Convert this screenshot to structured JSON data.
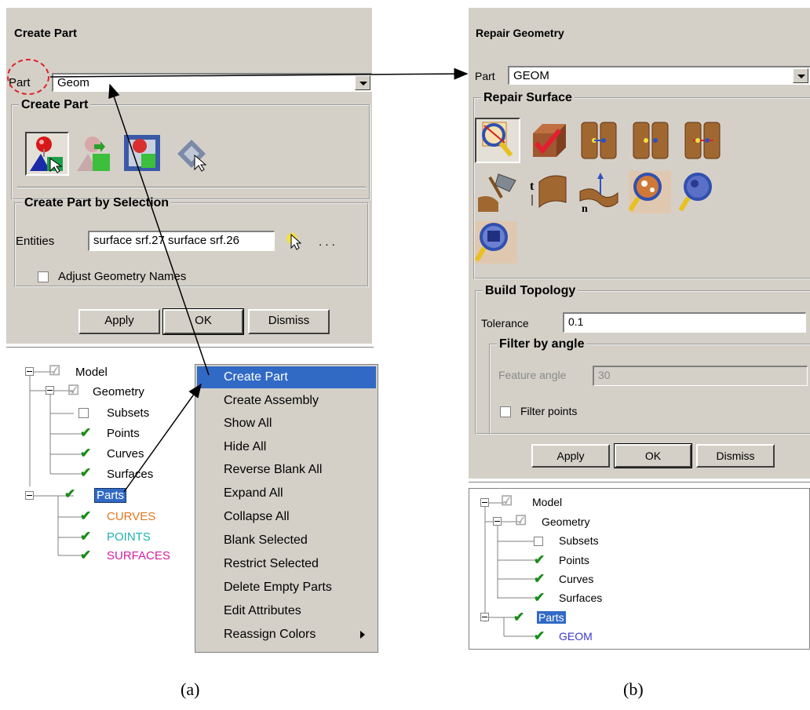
{
  "left": {
    "title": "Create Part",
    "part_label": "Part",
    "part_value": "Geom",
    "create_part_group": "Create Part",
    "selection_group": "Create Part by Selection",
    "entities_label": "Entities",
    "entities_value": "surface srf.27 surface srf.26",
    "dots": ". . .",
    "adjust_label": "Adjust Geometry Names",
    "apply": "Apply",
    "ok": "OK",
    "dismiss": "Dismiss",
    "tree": {
      "model": "Model",
      "geometry": "Geometry",
      "subsets": "Subsets",
      "points": "Points",
      "curves": "Curves",
      "surfaces": "Surfaces",
      "parts": "Parts",
      "part_items": [
        {
          "label": "CURVES",
          "color": "#e07820"
        },
        {
          "label": "POINTS",
          "color": "#20b0b0"
        },
        {
          "label": "SURFACES",
          "color": "#d020a0"
        }
      ]
    },
    "menu": [
      "Create Part",
      "Create Assembly",
      "Show All",
      "Hide All",
      "Reverse Blank All",
      "Expand All",
      "Collapse All",
      "Blank Selected",
      "Restrict Selected",
      "Delete Empty Parts",
      "Edit Attributes",
      "Reassign Colors"
    ],
    "caption": "(a)"
  },
  "right": {
    "title": "Repair Geometry",
    "part_label": "Part",
    "part_value": "GEOM",
    "repair_group": "Repair Surface",
    "topology_group": "Build Topology",
    "tolerance_label": "Tolerance",
    "tolerance_value": "0.1",
    "filter_group": "Filter by angle",
    "feature_label": "Feature angle",
    "feature_value": "30",
    "filter_points": "Filter points",
    "apply": "Apply",
    "ok": "OK",
    "dismiss": "Dismiss",
    "tree": {
      "model": "Model",
      "geometry": "Geometry",
      "subsets": "Subsets",
      "points": "Points",
      "curves": "Curves",
      "surfaces": "Surfaces",
      "parts": "Parts",
      "geom": "GEOM",
      "geom_color": "#3a3acc"
    },
    "caption": "(b)"
  },
  "colors": {
    "panel": "#d4d0c8",
    "selection": "#316ac5",
    "highlight_circle": "#e02020"
  }
}
